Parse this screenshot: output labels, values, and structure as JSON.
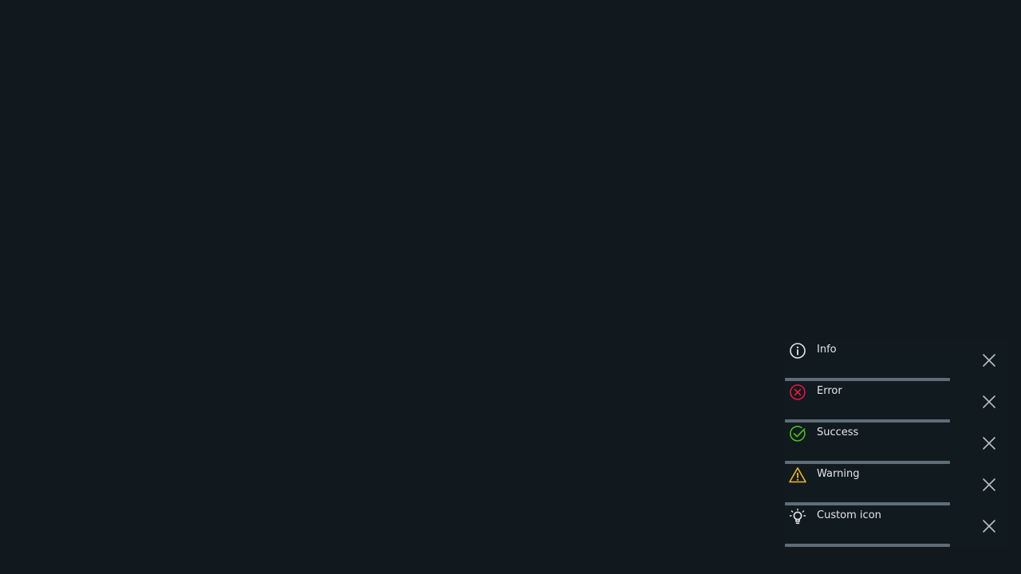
{
  "colors": {
    "background": "#12191e",
    "text": "#e3e6e8",
    "progress": "#5f6d78",
    "close": "#b8c0c6",
    "info": "#e3e6e8",
    "error": "#e2183f",
    "success": "#49bd19",
    "warning": "#f5b51e",
    "custom": "#e3e6e8"
  },
  "toasts": [
    {
      "message": "Info",
      "icon": "info-icon",
      "progress": 0.74
    },
    {
      "message": "Error",
      "icon": "error-icon",
      "progress": 0.74
    },
    {
      "message": "Success",
      "icon": "success-icon",
      "progress": 0.74
    },
    {
      "message": "Warning",
      "icon": "warning-icon",
      "progress": 0.74
    },
    {
      "message": "Custom icon",
      "icon": "lightbulb-icon",
      "progress": 0.74
    }
  ],
  "close_icon": "close-icon"
}
